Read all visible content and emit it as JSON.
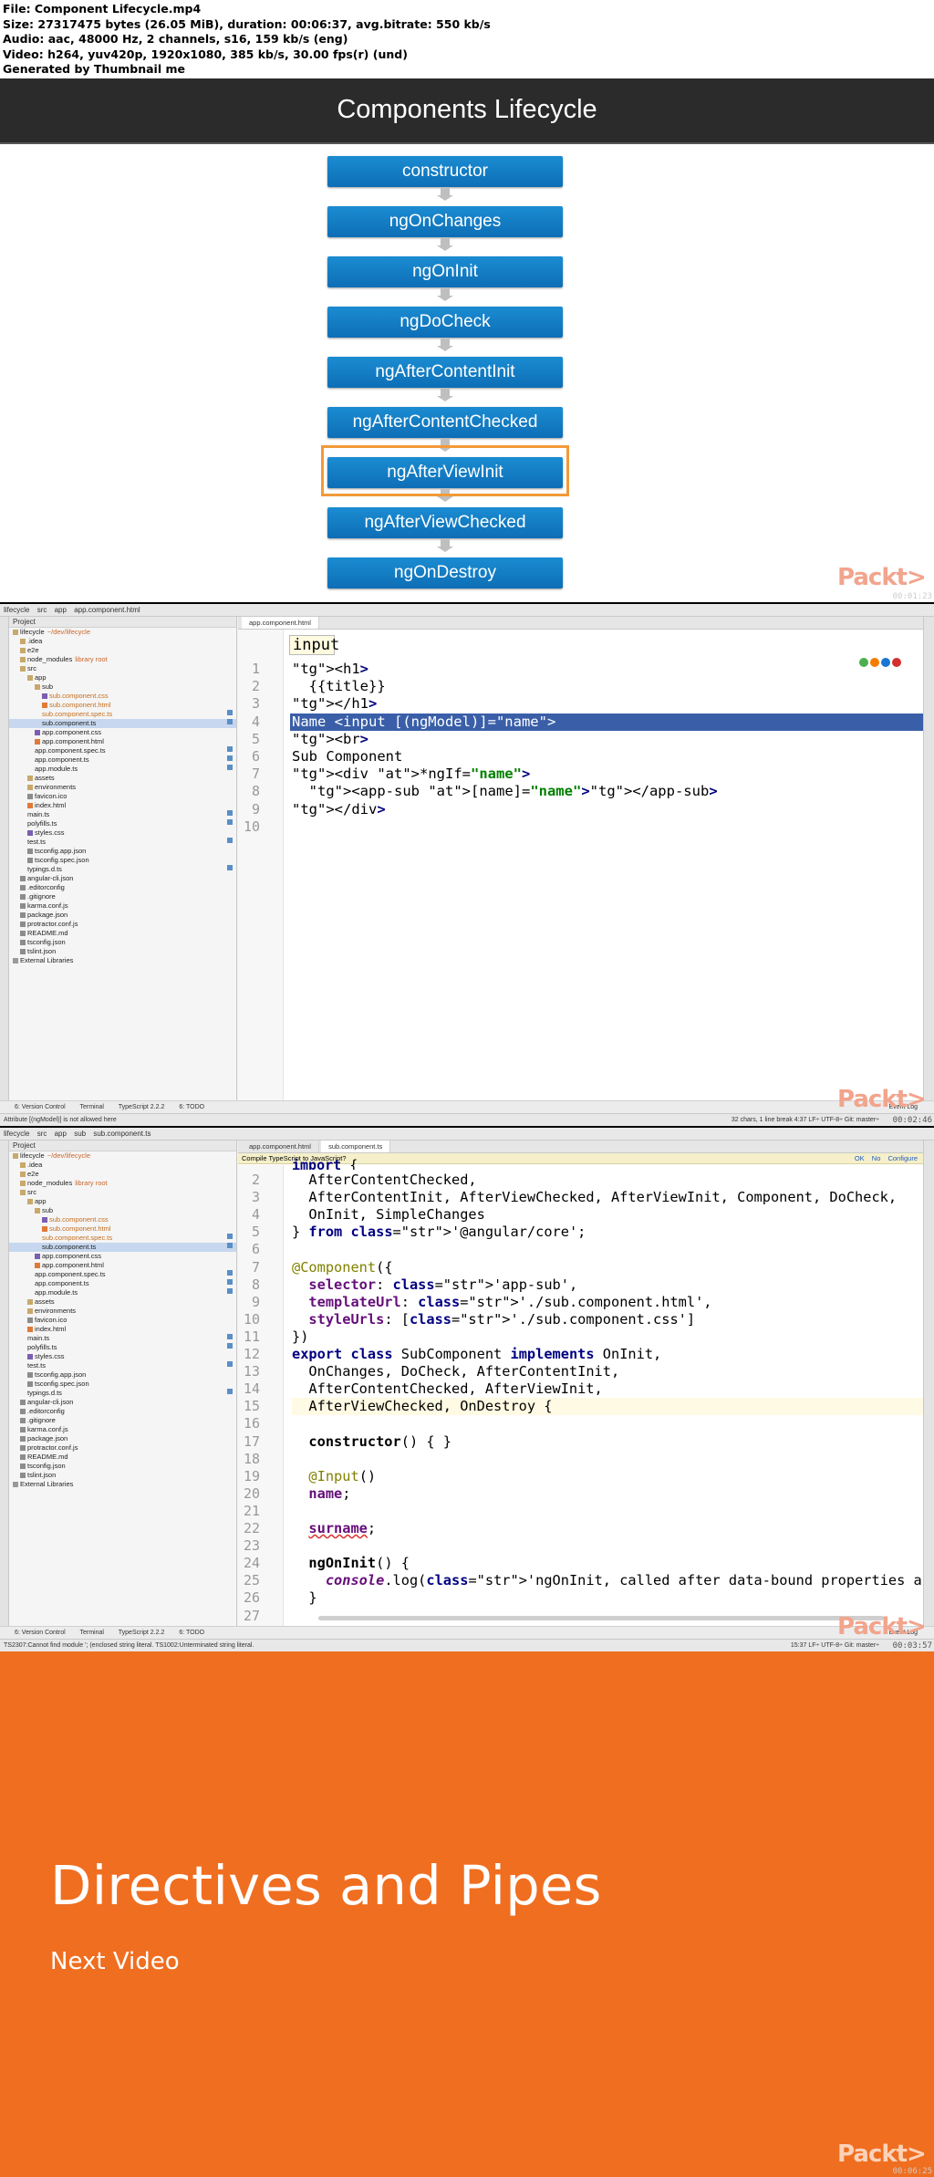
{
  "info": {
    "line1": "File: Component Lifecycle.mp4",
    "line2": "Size: 27317475 bytes (26.05 MiB), duration: 00:06:37, avg.bitrate: 550 kb/s",
    "line3": "Audio: aac, 48000 Hz, 2 channels, s16, 159 kb/s (eng)",
    "line4": "Video: h264, yuv420p, 1920x1080, 385 kb/s, 30.00 fps(r) (und)",
    "line5": "Generated by Thumbnail me"
  },
  "frame1": {
    "title": "Components Lifecycle",
    "steps": [
      "constructor",
      "ngOnChanges",
      "ngOnInit",
      "ngDoCheck",
      "ngAfterContentInit",
      "ngAfterContentChecked",
      "ngAfterViewInit",
      "ngAfterViewChecked",
      "ngOnDestroy"
    ],
    "highlighted": "ngAfterViewInit",
    "highlight_color": "#f29a38",
    "box_color": "#0d6eb6",
    "logo": "Packt>",
    "timestamp": "00:01:23"
  },
  "frame2": {
    "nav": [
      "lifecycle",
      "src",
      "app",
      "app.component.html"
    ],
    "project_header": "Project",
    "tab": "app.component.html",
    "tooltip": "input",
    "code_lines": [
      "<h1>",
      "  {{title}}",
      "</h1>",
      "Name <input [(ngModel)]=\"name\">",
      "<br>",
      "Sub Component",
      "<div *ngIf=\"name\">",
      "  <app-sub [name]=\"name\"></app-sub>",
      "</div>",
      ""
    ],
    "bottom_tabs": [
      "6: Version Control",
      "Terminal",
      "TypeScript 2.2.2",
      "6: TODO"
    ],
    "status": "Attribute [(ngModel)] is not allowed here",
    "status_right": "32 chars, 1 line break    4:37    LF÷    UTF-8÷    Git: master÷",
    "event_log": "Event Log",
    "timestamp": "00:02:46"
  },
  "frame3": {
    "nav": [
      "lifecycle",
      "src",
      "app",
      "sub",
      "sub.component.ts"
    ],
    "tabs": [
      "app.component.html",
      "sub.component.ts"
    ],
    "banner": "Compile TypeScript to JavaScript?",
    "banner_actions": [
      "OK",
      "No",
      "Configure"
    ],
    "first_line": "import {",
    "code_lines": [
      "  AfterContentChecked,",
      "  AfterContentInit, AfterViewChecked, AfterViewInit, Component, DoCheck,",
      "  OnInit, SimpleChanges",
      "} from '@angular/core';",
      "",
      "@Component({",
      "  selector: 'app-sub',",
      "  templateUrl: './sub.component.html',",
      "  styleUrls: ['./sub.component.css']",
      "})",
      "export class SubComponent implements OnInit,",
      "  OnChanges, DoCheck, AfterContentInit,",
      "  AfterContentChecked, AfterViewInit,",
      "  AfterViewChecked, OnDestroy {",
      "",
      "  constructor() { }",
      "",
      "  @Input()",
      "  name;",
      "",
      "  surname;",
      "",
      "  ngOnInit() {",
      "    console.log('ngOnInit, called after data-bound properties are init')",
      "  }",
      ""
    ],
    "bottom_tabs": [
      "6: Version Control",
      "Terminal",
      "TypeScript 2.2.2",
      "6: TODO"
    ],
    "status": "TS2307:Cannot find module '; (enclosed string literal. TS1002:Unterminated string literal.",
    "status_right": "15:37    LF÷    UTF-8÷    Git: master÷",
    "event_log": "Event Log",
    "timestamp": "00:03:57"
  },
  "tree": [
    {
      "label": "lifecycle",
      "hint": "~/dev/lifecycle",
      "indent": 0,
      "icon": "folder"
    },
    {
      "label": ".idea",
      "indent": 1,
      "icon": "folder"
    },
    {
      "label": "e2e",
      "indent": 1,
      "icon": "folder"
    },
    {
      "label": "node_modules",
      "hint": "library root",
      "indent": 1,
      "icon": "folder"
    },
    {
      "label": "src",
      "indent": 1,
      "icon": "folder"
    },
    {
      "label": "app",
      "indent": 2,
      "icon": "folder"
    },
    {
      "label": "sub",
      "indent": 3,
      "icon": "folder"
    },
    {
      "label": "sub.component.css",
      "indent": 4,
      "icon": "css",
      "modified": true
    },
    {
      "label": "sub.component.html",
      "indent": 4,
      "icon": "html",
      "modified": true
    },
    {
      "label": "sub.component.spec.ts",
      "indent": 4,
      "icon": "ts",
      "modified": true
    },
    {
      "label": "sub.component.ts",
      "indent": 4,
      "icon": "ts",
      "selected": true
    },
    {
      "label": "app.component.css",
      "indent": 3,
      "icon": "css"
    },
    {
      "label": "app.component.html",
      "indent": 3,
      "icon": "html"
    },
    {
      "label": "app.component.spec.ts",
      "indent": 3,
      "icon": "ts"
    },
    {
      "label": "app.component.ts",
      "indent": 3,
      "icon": "ts"
    },
    {
      "label": "app.module.ts",
      "indent": 3,
      "icon": "ts"
    },
    {
      "label": "assets",
      "indent": 2,
      "icon": "folder"
    },
    {
      "label": "environments",
      "indent": 2,
      "icon": "folder"
    },
    {
      "label": "favicon.ico",
      "indent": 2,
      "icon": "json"
    },
    {
      "label": "index.html",
      "indent": 2,
      "icon": "html"
    },
    {
      "label": "main.ts",
      "indent": 2,
      "icon": "ts"
    },
    {
      "label": "polyfills.ts",
      "indent": 2,
      "icon": "ts"
    },
    {
      "label": "styles.css",
      "indent": 2,
      "icon": "css"
    },
    {
      "label": "test.ts",
      "indent": 2,
      "icon": "ts"
    },
    {
      "label": "tsconfig.app.json",
      "indent": 2,
      "icon": "json"
    },
    {
      "label": "tsconfig.spec.json",
      "indent": 2,
      "icon": "json"
    },
    {
      "label": "typings.d.ts",
      "indent": 2,
      "icon": "ts"
    },
    {
      "label": "angular-cli.json",
      "indent": 1,
      "icon": "json"
    },
    {
      "label": ".editorconfig",
      "indent": 1,
      "icon": "json"
    },
    {
      "label": ".gitignore",
      "indent": 1,
      "icon": "json"
    },
    {
      "label": "karma.conf.js",
      "indent": 1,
      "icon": "json"
    },
    {
      "label": "package.json",
      "indent": 1,
      "icon": "json"
    },
    {
      "label": "protractor.conf.js",
      "indent": 1,
      "icon": "json"
    },
    {
      "label": "README.md",
      "indent": 1,
      "icon": "json"
    },
    {
      "label": "tsconfig.json",
      "indent": 1,
      "icon": "json"
    },
    {
      "label": "tslint.json",
      "indent": 1,
      "icon": "json"
    },
    {
      "label": "External Libraries",
      "indent": 0,
      "icon": "lib"
    }
  ],
  "frame4": {
    "title": "Directives and Pipes",
    "subtitle": "Next Video",
    "background": "#f06e20",
    "logo": "Packt>",
    "timestamp": "00:06:25"
  }
}
